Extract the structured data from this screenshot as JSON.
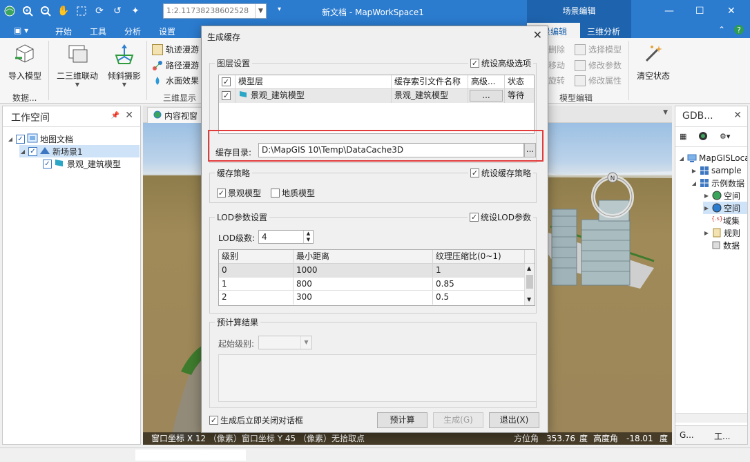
{
  "window": {
    "title": "新文档 - MapWorkSpace1",
    "scale_value": "1:2.11738238602528",
    "context_tab_header": "场景编辑"
  },
  "ribbon_tabs": [
    "开始",
    "工具",
    "分析",
    "设置"
  ],
  "context_tabs": [
    "场景编辑",
    "三维分析"
  ],
  "ribbon": {
    "import_model": "导入模型",
    "group_data": "数据...",
    "link_2d3d": "二三维联动",
    "oblique_photo": "倾斜摄影",
    "track_roam": "轨迹漫游",
    "path_roam": "路径漫游",
    "water_effect": "水面效果",
    "group_3d_display": "三维显示",
    "delete": "删除",
    "move": "移动",
    "rotate": "旋转",
    "select_model": "选择模型",
    "modify_params": "修改参数",
    "modify_attrs": "修改属性",
    "group_model_edit": "模型编辑",
    "clear_state": "清空状态"
  },
  "workspace": {
    "title": "工作空间",
    "tree": {
      "map_doc": "地图文档",
      "new_scene": "新场景1",
      "layer": "景观_建筑模型"
    }
  },
  "view": {
    "tab_label": "内容视窗",
    "status": {
      "left": "窗口坐标 X 12 （像素）窗口坐标 Y 45 （像素）无拾取点",
      "azimuth_label": "方位角",
      "azimuth_value": "353.76",
      "deg1": "度",
      "elevation_label": "高度角",
      "elevation_value": "-18.01",
      "deg2": "度"
    }
  },
  "gdb": {
    "title": "GDB...",
    "tree": [
      "MapGISLoca",
      "sample",
      "示例数据",
      "空间",
      "空间",
      "域集",
      "规则",
      "数据"
    ],
    "bottom_tabs": [
      "G...",
      "工..."
    ]
  },
  "dialog": {
    "title": "生成缓存",
    "layer_settings": {
      "title": "图层设置",
      "advanced_checkbox": "统设高级选项",
      "columns": [
        "模型层",
        "缓存索引文件名称",
        "高级...",
        "状态"
      ],
      "rows": [
        {
          "model_layer": "景观_建筑模型",
          "index_file": "景观_建筑模型",
          "advanced": "...",
          "status": "等待"
        }
      ]
    },
    "cache_dir_label": "缓存目录:",
    "cache_dir_value": "D:\\MapGIS 10\\Temp\\DataCache3D",
    "cache_dir_browse": "...",
    "strategy": {
      "title": "缓存策略",
      "unify_checkbox": "统设缓存策略",
      "landscape_model": "景观模型",
      "geology_model": "地质模型"
    },
    "lod": {
      "title": "LOD参数设置",
      "unify_checkbox": "统设LOD参数",
      "level_count_label": "LOD级数:",
      "level_count_value": "4",
      "columns": [
        "级别",
        "最小距离",
        "纹理压缩比(0~1)"
      ],
      "rows": [
        {
          "level": "0",
          "min_distance": "1000",
          "ratio": "1"
        },
        {
          "level": "1",
          "min_distance": "800",
          "ratio": "0.85"
        },
        {
          "level": "2",
          "min_distance": "300",
          "ratio": "0.5"
        }
      ]
    },
    "precalc": {
      "title": "预计算结果",
      "start_level_label": "起始级别:"
    },
    "close_after_checkbox": "生成后立即关闭对话框",
    "buttons": {
      "precompute": "预计算",
      "generate": "生成(G)",
      "exit": "退出(X)"
    }
  }
}
